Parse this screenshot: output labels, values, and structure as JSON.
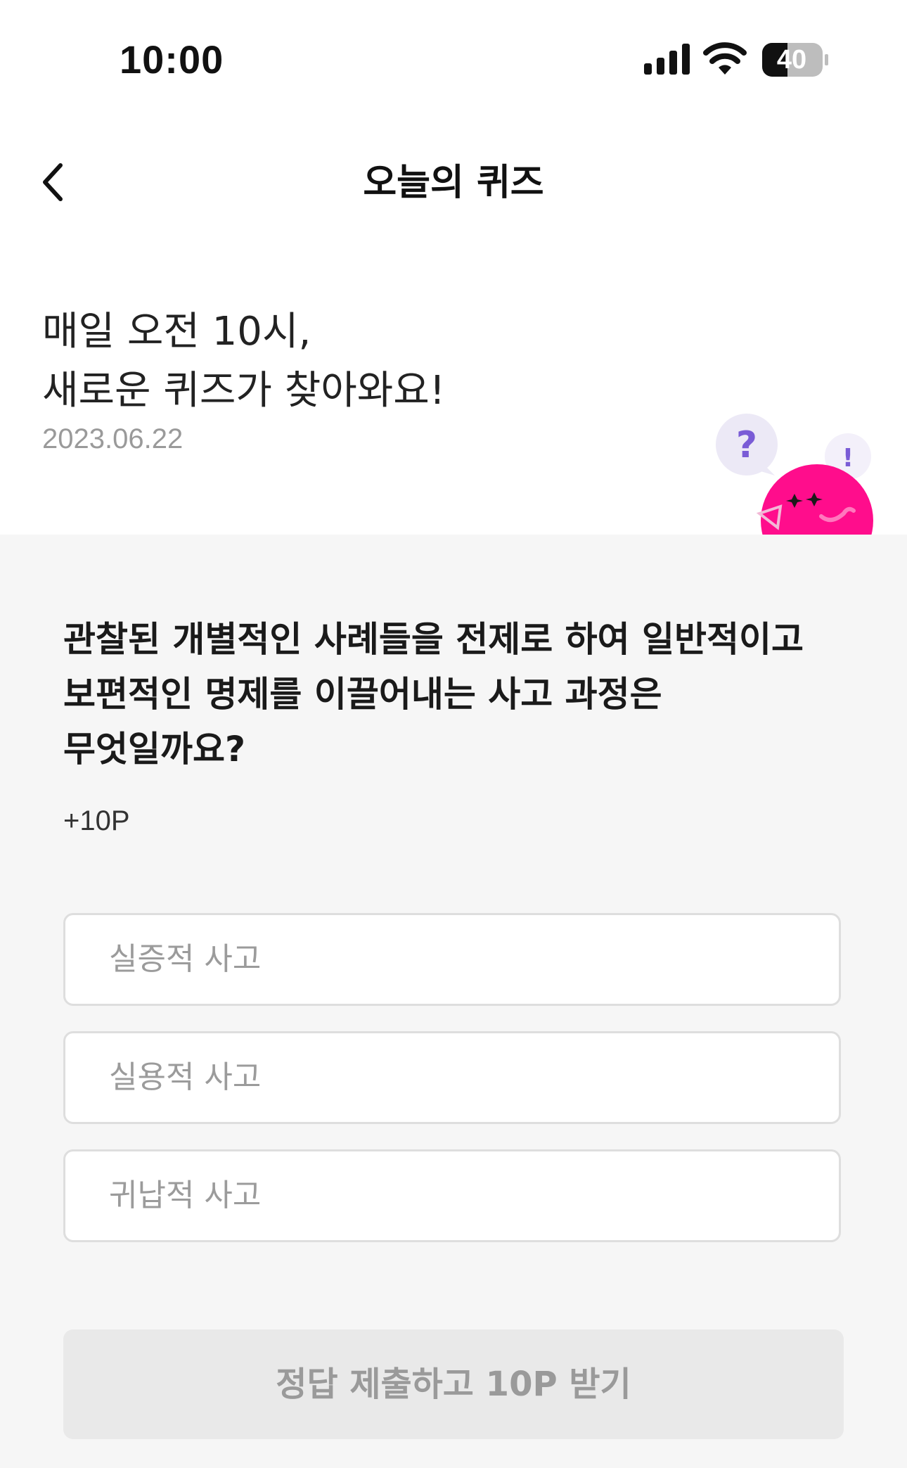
{
  "status_bar": {
    "time": "10:00",
    "battery": "40",
    "icons": [
      "signal-icon",
      "wifi-icon",
      "battery-icon"
    ]
  },
  "nav": {
    "title": "오늘의 퀴즈",
    "back_icon": "chevron-left-icon"
  },
  "intro": {
    "line1": "매일 오전 10시,",
    "line2": "새로운 퀴즈가 찾아와요!",
    "date": "2023.06.22"
  },
  "mascot": {
    "question_mark": "?",
    "exclamation_mark": "!",
    "color": "#ff0d8c",
    "bubble_color": "#ece9f6",
    "mark_color": "#7a5cd6"
  },
  "quiz": {
    "question": "관찰된 개별적인 사례들을 전제로 하여 일반적이고 보편적인 명제를 이끌어내는 사고 과정은 무엇일까요?",
    "reward": "+10P",
    "options": [
      {
        "label": "실증적 사고"
      },
      {
        "label": "실용적 사고"
      },
      {
        "label": "귀납적 사고"
      }
    ],
    "submit_label": "정답 제출하고 10P 받기"
  },
  "colors": {
    "background": "#ffffff",
    "section_bg": "#f6f6f6",
    "option_border": "#dedede",
    "placeholder_text": "#9b9b9b",
    "button_disabled_bg": "#e9e9e9"
  }
}
